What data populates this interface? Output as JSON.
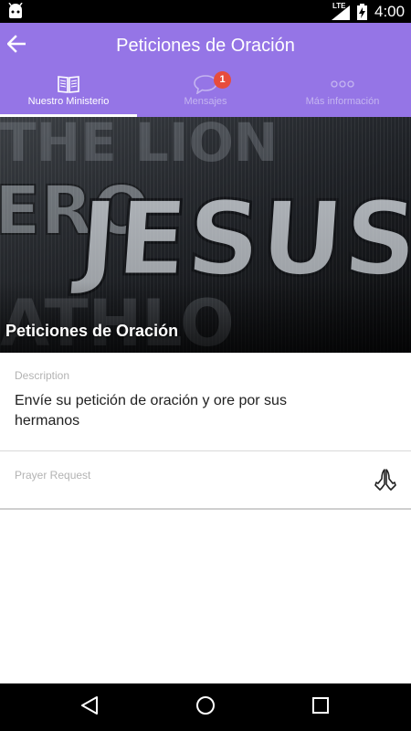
{
  "status_bar": {
    "network_label": "LTE",
    "time": "4:00",
    "icons": [
      "android-icon",
      "signal-icon",
      "battery-charging-icon"
    ]
  },
  "app_bar": {
    "title": "Peticiones de Oración",
    "background_color": "#9575e6",
    "back_icon": "arrow-back-icon"
  },
  "tabs": [
    {
      "label": "Nuestro Ministerio",
      "icon": "book-icon",
      "active": true
    },
    {
      "label": "Mensajes",
      "icon": "chat-bubble-icon",
      "active": false,
      "badge": "1"
    },
    {
      "label": "Más información",
      "icon": "more-dots-icon",
      "active": false
    }
  ],
  "hero": {
    "title": "Peticiones de Oración",
    "image": "carved-letters-jesus-photo"
  },
  "description": {
    "label": "Description",
    "text": "Envíe su petición de oración y ore por sus hermanos"
  },
  "prayer_request": {
    "label": "Prayer Request",
    "icon": "praying-hands-icon"
  },
  "nav_bar": {
    "icons": [
      "back-triangle-icon",
      "home-circle-icon",
      "recents-square-icon"
    ]
  }
}
